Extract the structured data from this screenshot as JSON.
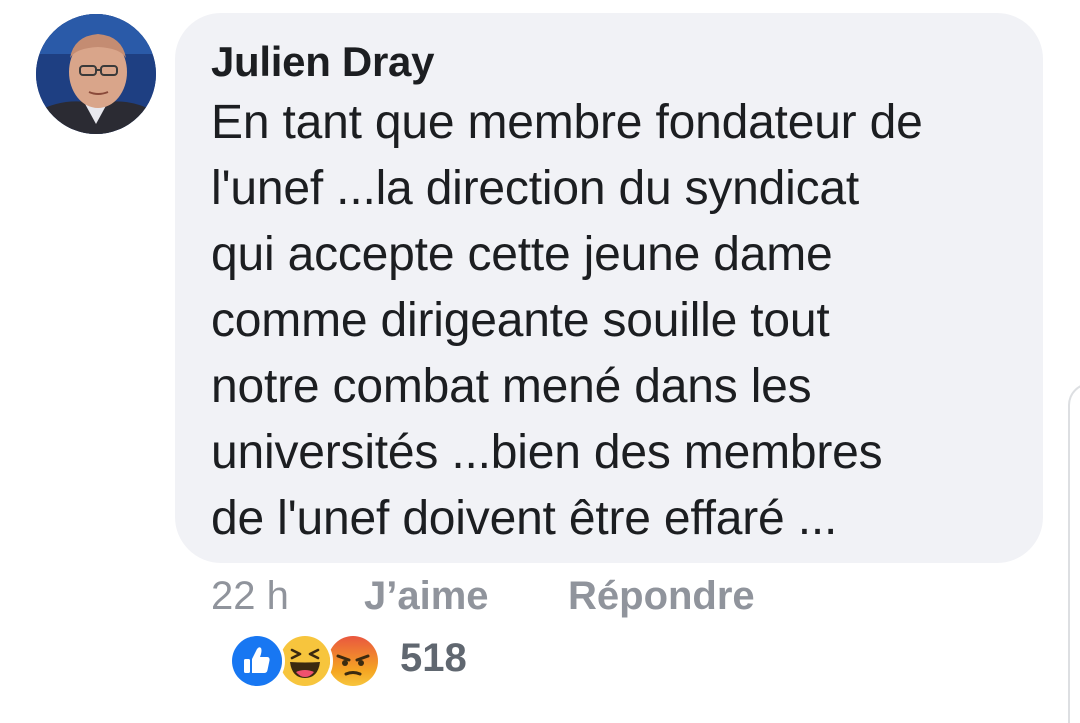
{
  "comment": {
    "author": "Julien Dray",
    "body_lines": [
      "En tant que membre fondateur de",
      "l'unef ...la direction du syndicat",
      "qui accepte cette jeune dame",
      "comme dirigeante souille tout",
      "notre combat mené dans les",
      "universités ...bien des membres",
      "de l'unef doivent être effaré ..."
    ],
    "timestamp": "22 h",
    "like_label": "J’aime",
    "reply_label": "Répondre",
    "reactions": {
      "icons": [
        "like-icon",
        "haha-icon",
        "angry-icon"
      ],
      "count": "518"
    }
  },
  "colors": {
    "bubble_bg": "#f1f2f6",
    "text": "#1c1e21",
    "meta_text": "#90949c",
    "count_text": "#606770",
    "like_blue": "#1877f2",
    "haha_yellow": "#f7c53d",
    "angry_red": "#e9573f"
  }
}
